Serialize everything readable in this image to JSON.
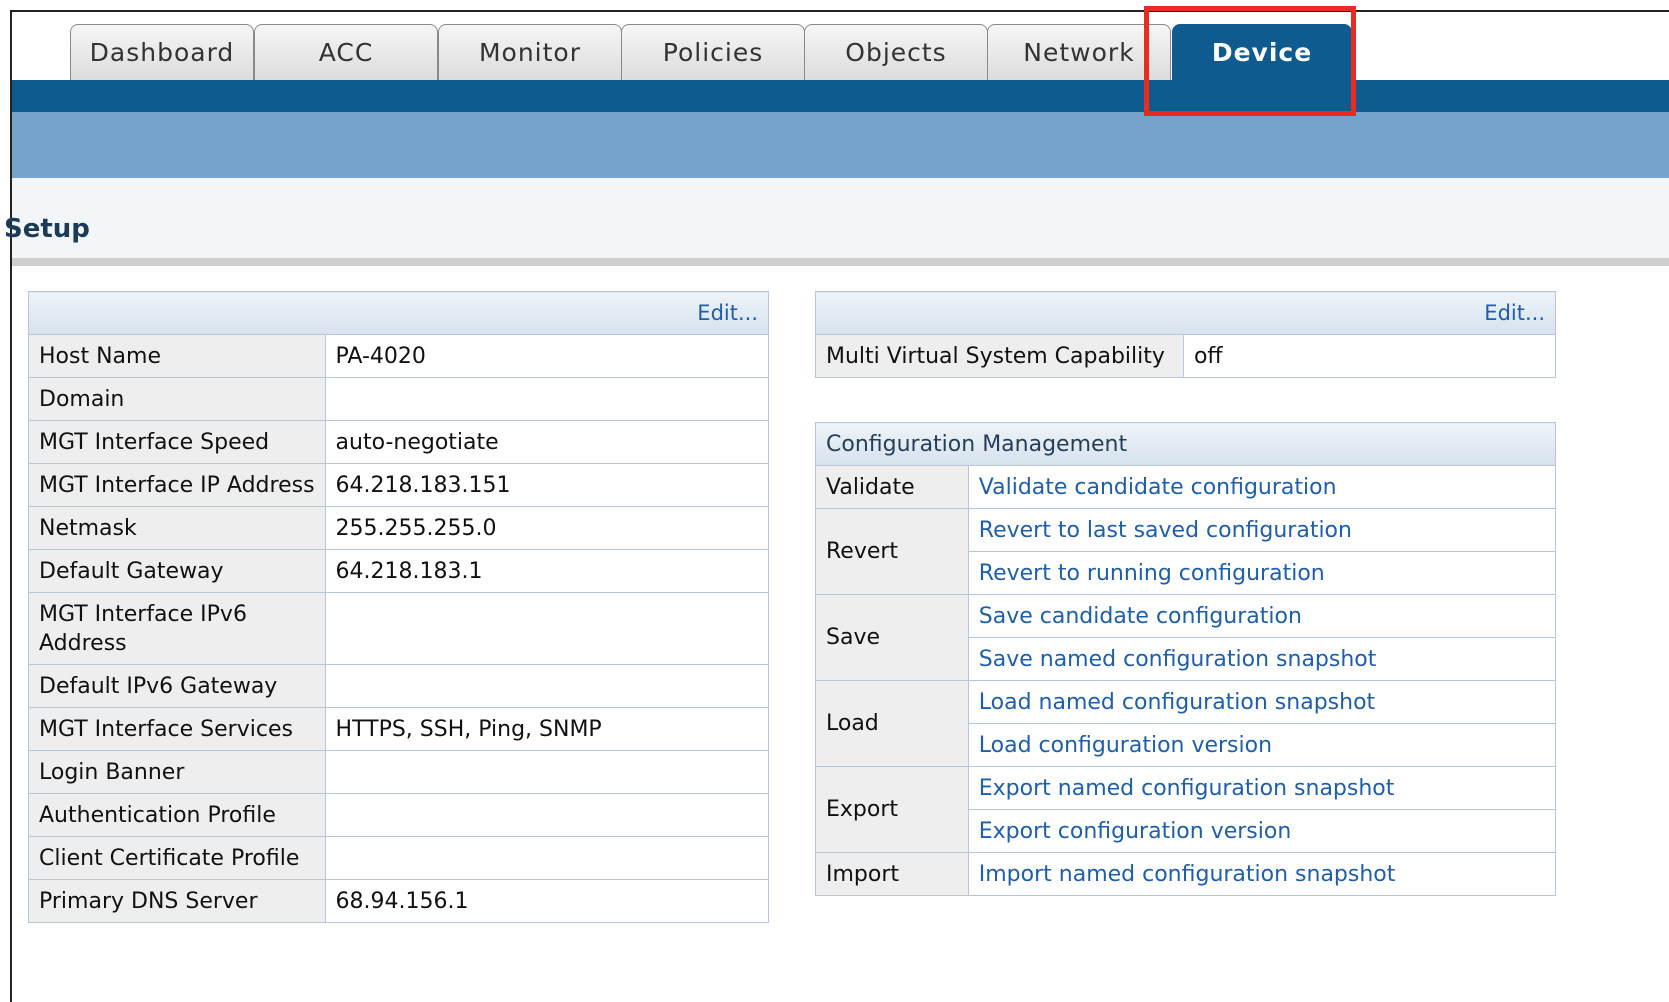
{
  "tabs": [
    "Dashboard",
    "ACC",
    "Monitor",
    "Policies",
    "Objects",
    "Network",
    "Device"
  ],
  "active_tab": "Device",
  "page_title": "Setup",
  "left_panel": {
    "edit_label": "Edit...",
    "rows": [
      {
        "label": "Host Name",
        "value": "PA-4020"
      },
      {
        "label": "Domain",
        "value": ""
      },
      {
        "label": "MGT Interface Speed",
        "value": "auto-negotiate"
      },
      {
        "label": "MGT Interface IP Address",
        "value": "64.218.183.151"
      },
      {
        "label": "Netmask",
        "value": "255.255.255.0"
      },
      {
        "label": "Default Gateway",
        "value": "64.218.183.1"
      },
      {
        "label": "MGT Interface IPv6 Address",
        "value": ""
      },
      {
        "label": "Default IPv6 Gateway",
        "value": ""
      },
      {
        "label": "MGT Interface Services",
        "value": "HTTPS, SSH, Ping, SNMP"
      },
      {
        "label": "Login Banner",
        "value": ""
      },
      {
        "label": "Authentication Profile",
        "value": ""
      },
      {
        "label": "Client Certificate Profile",
        "value": ""
      },
      {
        "label": "Primary DNS Server",
        "value": "68.94.156.1"
      }
    ]
  },
  "right_panel": {
    "edit_label": "Edit...",
    "mvs_label": "Multi Virtual System Capability",
    "mvs_value": "off"
  },
  "config_mgmt": {
    "title": "Configuration Management",
    "groups": [
      {
        "name": "Validate",
        "links": [
          "Validate candidate configuration"
        ]
      },
      {
        "name": "Revert",
        "links": [
          "Revert to last saved configuration",
          "Revert to running configuration"
        ]
      },
      {
        "name": "Save",
        "links": [
          "Save candidate configuration",
          "Save named configuration snapshot"
        ]
      },
      {
        "name": "Load",
        "links": [
          "Load named configuration snapshot",
          "Load configuration version"
        ]
      },
      {
        "name": "Export",
        "links": [
          "Export named configuration snapshot",
          "Export configuration version"
        ]
      },
      {
        "name": "Import",
        "links": [
          "Import named configuration snapshot"
        ]
      }
    ]
  },
  "colors": {
    "accent": "#0f5b8f",
    "band": "#76a3cc",
    "highlight": "#ea2b1f",
    "link": "#1f5ea8"
  }
}
